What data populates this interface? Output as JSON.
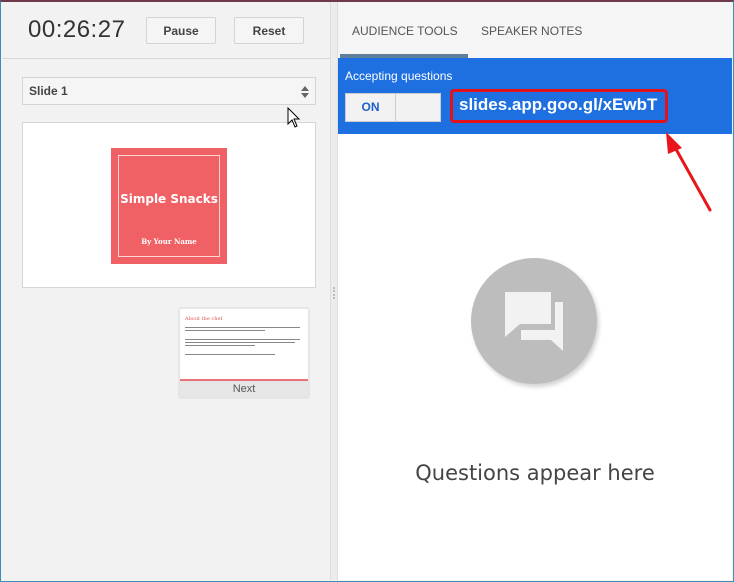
{
  "presenter": {
    "timer": "00:26:27",
    "pause_label": "Pause",
    "reset_label": "Reset",
    "slide_select": "Slide 1",
    "current_slide": {
      "title": "Simple Snacks",
      "subtitle": "By Your Name",
      "color": "#f06166"
    },
    "next_slide": {
      "title": "About the chef",
      "label": "Next"
    }
  },
  "tabs": [
    {
      "label": "AUDIENCE TOOLS",
      "active": true
    },
    {
      "label": "SPEAKER NOTES",
      "active": false
    }
  ],
  "audience": {
    "accepting_label": "Accepting questions",
    "toggle_label": "ON",
    "toggle_state": "on",
    "url": "slides.app.goo.gl/xEwbT",
    "accent_color": "#1e6fe0",
    "highlight_color": "#e0121a",
    "empty_message": "Questions appear here"
  }
}
